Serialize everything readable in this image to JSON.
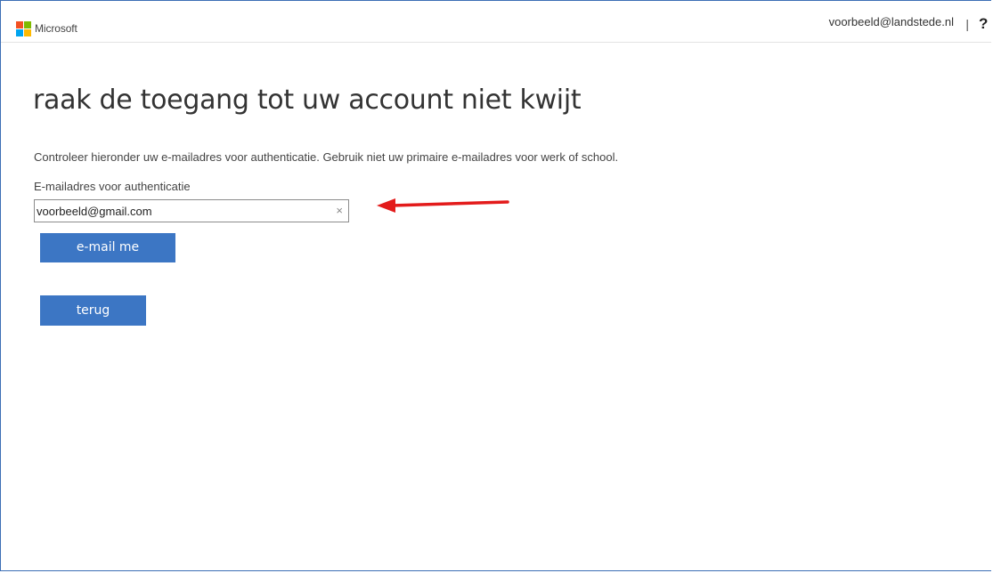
{
  "header": {
    "brand": "Microsoft",
    "user_email": "voorbeeld@landstede.nl",
    "separator": "|",
    "help": "?"
  },
  "main": {
    "title": "raak de toegang tot uw account niet kwijt",
    "description": "Controleer hieronder uw e-mailadres voor authenticatie. Gebruik niet uw primaire e-mailadres voor werk of school.",
    "field_label": "E-mailadres voor authenticatie",
    "email_value": "voorbeeld@gmail.com",
    "clear_glyph": "×",
    "email_button": "e-mail me",
    "back_button": "terug"
  },
  "icons": {
    "logo": "microsoft-logo-icon",
    "clear": "clear-icon",
    "annotation": "red-arrow-annotation"
  },
  "colors": {
    "button": "#3c76c4",
    "arrow": "#e31b1b",
    "logo_red": "#f25022",
    "logo_green": "#7fba00",
    "logo_blue": "#00a4ef",
    "logo_yellow": "#ffb900"
  }
}
